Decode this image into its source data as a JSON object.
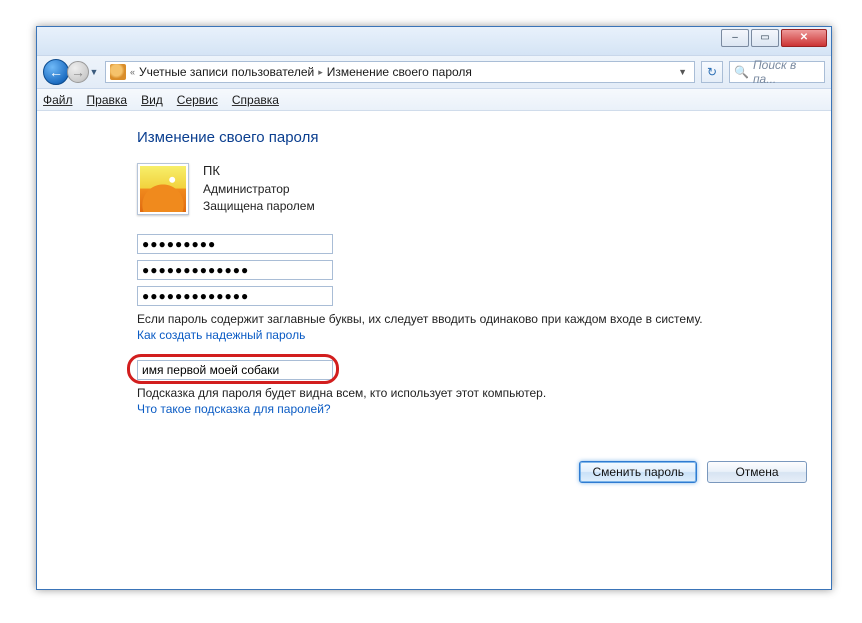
{
  "titlebar": {
    "minimize_glyph": "–",
    "maximize_glyph": "▭",
    "close_glyph": "✕"
  },
  "nav": {
    "back_glyph": "←",
    "fwd_glyph": "→",
    "dd_glyph": "▼",
    "refresh_glyph": "↻",
    "prefix_glyph": "«",
    "seg1": "Учетные записи пользователей",
    "chev": "▸",
    "seg2": "Изменение своего пароля",
    "search_glyph": "🔍",
    "search_placeholder": "Поиск в па..."
  },
  "menu": {
    "file": "Файл",
    "edit": "Правка",
    "view": "Вид",
    "tools": "Сервис",
    "help": "Справка"
  },
  "page": {
    "heading": "Изменение своего пароля",
    "user_name": "ПК",
    "user_role": "Администратор",
    "user_protection": "Защищена паролем",
    "pw_current": "●●●●●●●●●",
    "pw_new": "●●●●●●●●●●●●●",
    "pw_confirm": "●●●●●●●●●●●●●",
    "caps_note": "Если пароль содержит заглавные буквы, их следует вводить одинаково при каждом входе в систему.",
    "link_strong": "Как создать надежный пароль",
    "hint_value": "имя первой моей собаки",
    "hint_note": "Подсказка для пароля будет видна всем, кто использует этот компьютер.",
    "link_hint": "Что такое подсказка для паролей?",
    "btn_change": "Сменить пароль",
    "btn_cancel": "Отмена"
  }
}
